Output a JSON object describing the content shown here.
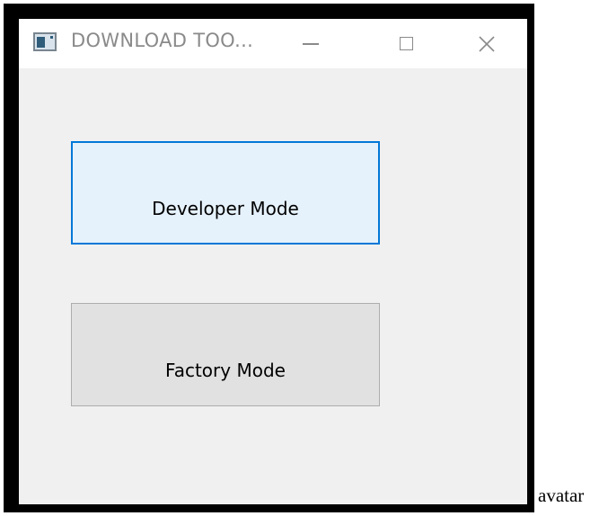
{
  "window": {
    "title": "DOWNLOAD TOO...",
    "icon": "app-window-icon",
    "controls": {
      "minimize_icon": "minimize-icon",
      "maximize_icon": "maximize-icon",
      "close_icon": "close-icon",
      "close_glyph": "✕"
    }
  },
  "main": {
    "developer_mode_label": "Developer Mode",
    "factory_mode_label": "Factory Mode"
  },
  "caption": {
    "text": "avatar"
  },
  "colors": {
    "accent": "#0078d7",
    "focused_button_bg": "#e5f1fb",
    "button_bg": "#e1e1e1",
    "window_bg": "#f0f0f0"
  }
}
